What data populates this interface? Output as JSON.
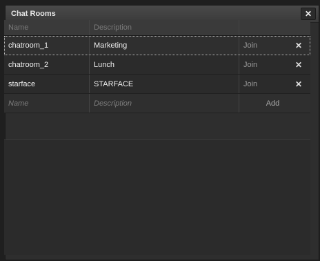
{
  "window": {
    "title": "Chat Rooms",
    "close_label": "✕"
  },
  "columns": {
    "name": "Name",
    "description": "Description",
    "actions": ""
  },
  "rooms": [
    {
      "name": "chatroom_1",
      "description": "Marketing",
      "join_label": "Join",
      "remove_label": "✕"
    },
    {
      "name": "chatroom_2",
      "description": "Lunch",
      "join_label": "Join",
      "remove_label": "✕"
    },
    {
      "name": "starface",
      "description": "STARFACE",
      "join_label": "Join",
      "remove_label": "✕"
    }
  ],
  "new_room": {
    "name_placeholder": "Name",
    "description_placeholder": "Description",
    "add_label": "Add"
  },
  "colors": {
    "window_bg": "#2e2e2e",
    "header_bg": "#3a3a3a",
    "accent": "#ffffff"
  }
}
